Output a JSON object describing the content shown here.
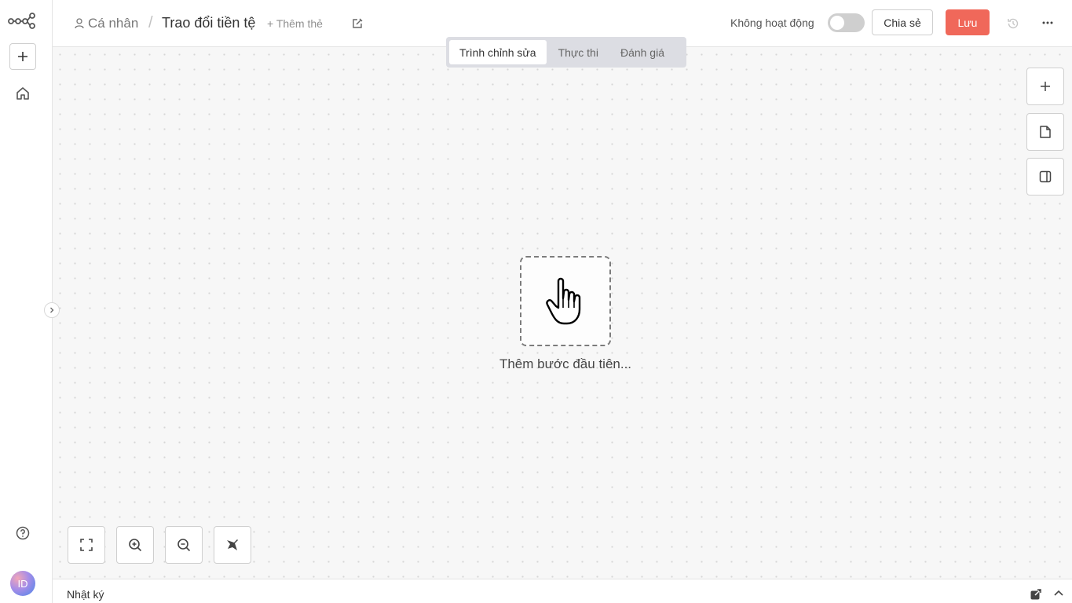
{
  "breadcrumb": {
    "owner": "Cá nhân",
    "separator": "/",
    "title": "Trao đổi tiền tệ",
    "add_tag": "+ Thêm thẻ"
  },
  "header": {
    "status_label": "Không hoạt động",
    "share_label": "Chia sẻ",
    "save_label": "Lưu"
  },
  "view_tabs": [
    {
      "label": "Trình chỉnh sửa",
      "active": true
    },
    {
      "label": "Thực thi",
      "active": false
    },
    {
      "label": "Đánh giá",
      "active": false
    }
  ],
  "canvas": {
    "first_step_label": "Thêm bước đầu tiên..."
  },
  "sidebar": {
    "avatar_initials": "ID"
  },
  "log": {
    "label": "Nhật ký"
  },
  "icons": {
    "logo": "workflow-logo-icon",
    "add": "plus-icon",
    "home": "home-icon",
    "help": "help-icon",
    "user": "user-icon",
    "edit": "edit-icon",
    "history": "history-icon",
    "more": "more-icon",
    "note": "sticky-note-icon",
    "panel": "panel-icon",
    "fit": "fit-view-icon",
    "zoom_in": "zoom-in-icon",
    "zoom_out": "zoom-out-icon",
    "clean": "tidy-up-icon",
    "pointer": "hand-pointer-icon"
  },
  "colors": {
    "accent": "#f0685a",
    "toggle_off": "#cfcfcf",
    "tabs_bg": "#dcdde3"
  }
}
